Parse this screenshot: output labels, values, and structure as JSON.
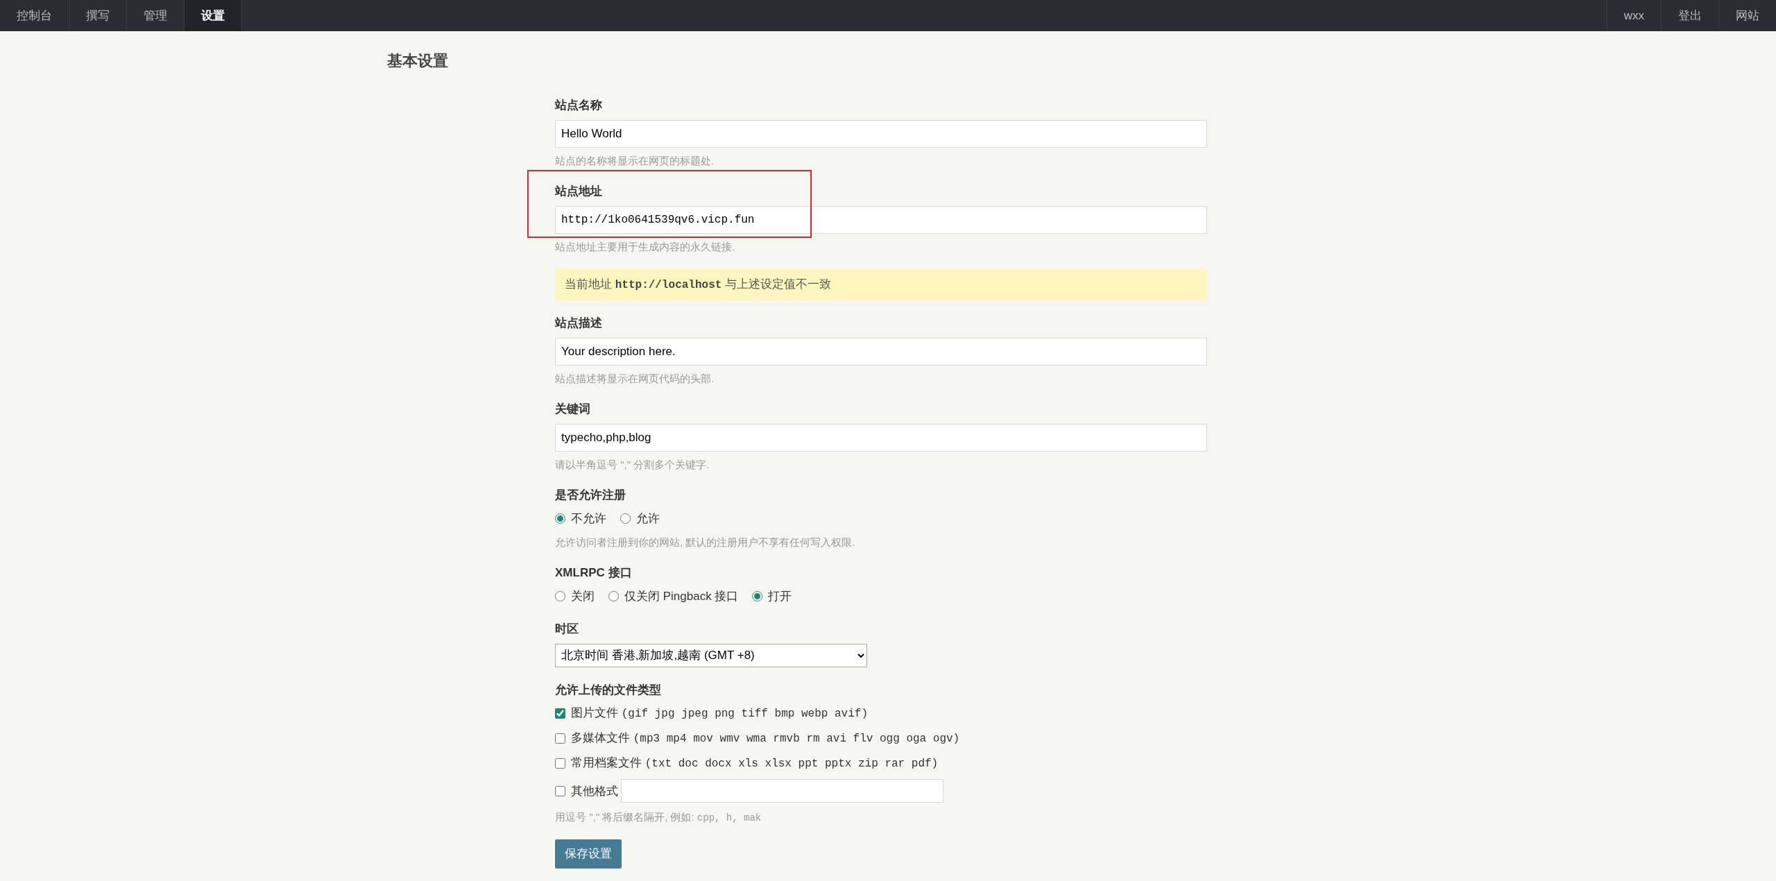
{
  "nav": {
    "left": [
      {
        "label": "控制台",
        "selected": false
      },
      {
        "label": "撰写",
        "selected": false
      },
      {
        "label": "管理",
        "selected": false
      },
      {
        "label": "设置",
        "selected": true
      }
    ],
    "right": [
      {
        "label": "wxx"
      },
      {
        "label": "登出"
      },
      {
        "label": "网站"
      }
    ]
  },
  "page_title": "基本设置",
  "fields": [
    {
      "kind": "text",
      "label": "站点名称",
      "value": "Hello World",
      "hint": "站点的名称将显示在网页的标题处.",
      "mono": false,
      "highlighted": false
    },
    {
      "kind": "text",
      "label": "站点地址",
      "value": "http://1ko0641539qv6.vicp.fun",
      "hint": "站点地址主要用于生成内容的永久链接.",
      "mono": true,
      "highlighted": true
    },
    {
      "kind": "notice",
      "text": "当前地址",
      "code": "http://localhost",
      "suffix": "与上述设定值不一致"
    },
    {
      "kind": "text",
      "label": "站点描述",
      "value": "Your description here.",
      "hint": "站点描述将显示在网页代码的头部.",
      "mono": false,
      "highlighted": false
    },
    {
      "kind": "text",
      "label": "关键词",
      "value": "typecho,php,blog",
      "hint": "请以半角逗号 \",\" 分割多个关键字.",
      "mono": false,
      "highlighted": false
    },
    {
      "kind": "radio",
      "label": "是否允许注册",
      "options": [
        {
          "label": "不允许",
          "selected": true
        },
        {
          "label": "允许",
          "selected": false
        }
      ],
      "hint": "允许访问者注册到你的网站, 默认的注册用户不享有任何写入权限."
    },
    {
      "kind": "radio",
      "label": "XMLRPC 接口",
      "options": [
        {
          "label": "关闭",
          "selected": false
        },
        {
          "label": "仅关闭 Pingback 接口",
          "selected": false
        },
        {
          "label": "打开",
          "selected": true
        }
      ]
    },
    {
      "kind": "select",
      "label": "时区",
      "value": "北京时间 香港,新加坡,越南 (GMT +8)"
    },
    {
      "kind": "checkboxes",
      "label": "允许上传的文件类型",
      "options": [
        {
          "kind": "type",
          "label": "图片文件",
          "extensions": "(gif jpg jpeg png tiff bmp webp avif)",
          "checked": true
        },
        {
          "kind": "type",
          "label": "多媒体文件",
          "extensions": "(mp3 mp4 mov wmv wma rmvb rm avi flv ogg oga ogv)",
          "checked": false
        },
        {
          "kind": "type",
          "label": "常用档案文件",
          "extensions": "(txt doc docx xls xlsx ppt pptx zip rar pdf)",
          "checked": false
        },
        {
          "kind": "custom",
          "label": "其他格式",
          "checked": false
        }
      ],
      "hint": "用逗号 \",\" 将后缀名隔开, 例如:",
      "hint_code": "cpp, h, mak"
    }
  ],
  "submit": "保存设置"
}
